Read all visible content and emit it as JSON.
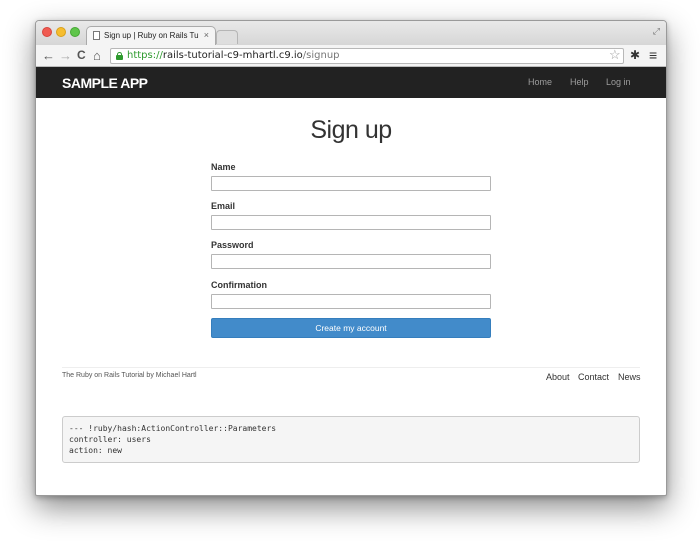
{
  "browser": {
    "tab_title": "Sign up | Ruby on Rails Tu",
    "tab_close": "×",
    "url_scheme": "https://",
    "url_host": "rails-tutorial-c9-mhartl.c9.io",
    "url_path": "/signup",
    "back_glyph": "←",
    "forward_glyph": "→",
    "reload_glyph": "C",
    "home_glyph": "⌂",
    "star_glyph": "☆",
    "settings_glyph": "✱",
    "menu_glyph": "≡",
    "expand_glyph": "⤢"
  },
  "navbar": {
    "logo": "SAMPLE APP",
    "links": [
      "Home",
      "Help",
      "Log in"
    ]
  },
  "form": {
    "title": "Sign up",
    "fields": [
      "Name",
      "Email",
      "Password",
      "Confirmation"
    ],
    "submit_label": "Create my account"
  },
  "footer": {
    "credit": "The Ruby on Rails Tutorial by Michael Hartl",
    "links": [
      "About",
      "Contact",
      "News"
    ]
  },
  "debug": {
    "text": "--- !ruby/hash:ActionController::Parameters\ncontroller: users\naction: new"
  },
  "colors": {
    "navbar_bg": "#222222",
    "primary_button": "#428bca",
    "secure_green": "#2e9a2e"
  }
}
